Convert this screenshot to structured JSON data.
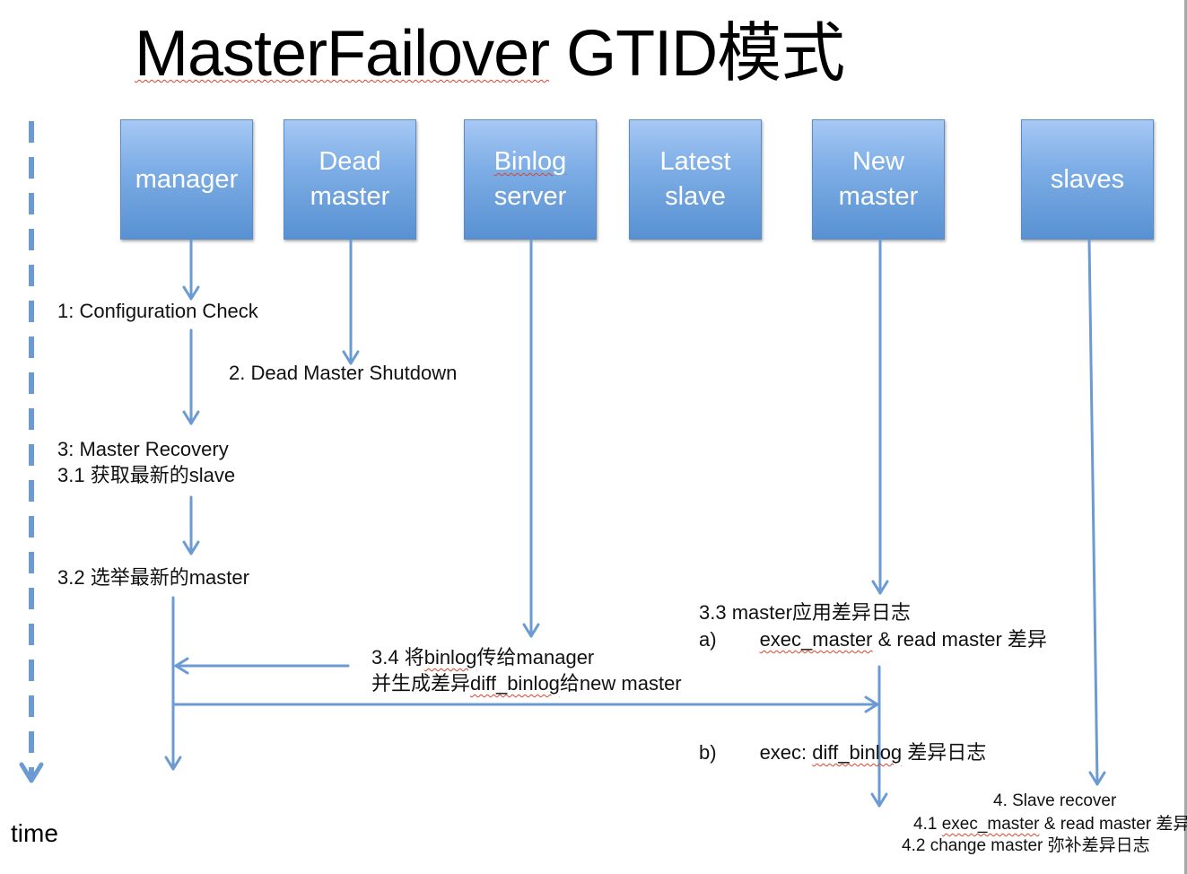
{
  "title": {
    "prefix": "MasterFailover",
    "suffix": " GTID模式"
  },
  "colors": {
    "box_top": "#a6c8f4",
    "box_bottom": "#5891d2",
    "arrow": "#6b9bd2",
    "text": "#111111",
    "spellcheck": "#d9442c"
  },
  "actors": [
    {
      "id": "manager",
      "label": "manager"
    },
    {
      "id": "dead-master",
      "label": "Dead\nmaster"
    },
    {
      "id": "binlog-server",
      "label_line1": "Binlog",
      "label_line2": "server"
    },
    {
      "id": "latest-slave",
      "label": "Latest\nslave"
    },
    {
      "id": "new-master",
      "label": "New\nmaster"
    },
    {
      "id": "slaves",
      "label": "slaves"
    }
  ],
  "steps": {
    "s1": "1: Configuration Check",
    "s2": "2. Dead Master Shutdown",
    "s3": "3: Master Recovery",
    "s3_1": "3.1 获取最新的slave",
    "s3_2": "3.2  选举最新的master",
    "s3_3": "3.3 master应用差异日志",
    "s3_3a_label": "a)",
    "s3_3a_sq": "exec_master",
    "s3_3a_rest": " & read master 差异",
    "s3_3b_label": "b)",
    "s3_3b_pre": "exec: ",
    "s3_3b_sq": "diff_binlog",
    "s3_3b_rest": " 差异日志",
    "s3_4_pre": "3.4  将",
    "s3_4_sq": "binlog",
    "s3_4_rest": "传给manager",
    "s3_4b_pre": "并生成差异",
    "s3_4b_sq": "diff_binlog",
    "s3_4b_rest": "给new master",
    "s4": "4. Slave recover",
    "s4_1_pre": "4.1 ",
    "s4_1_sq": "exec_master",
    "s4_1_rest": " & read master 差异",
    "s4_2": "4.2 change master 弥补差异日志"
  },
  "axis": {
    "label": "time"
  }
}
